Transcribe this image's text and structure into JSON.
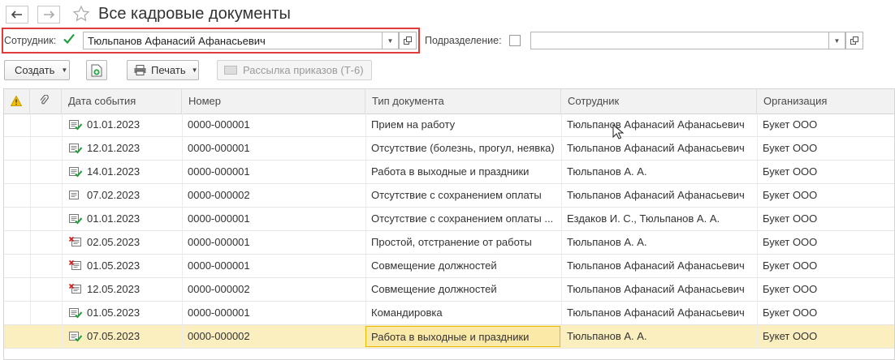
{
  "window": {
    "title": "Все кадровые документы"
  },
  "filters": {
    "employee_label": "Сотрудник:",
    "employee_value": "Тюльпанов Афанасий Афанасьевич",
    "department_label": "Подразделение:",
    "department_value": ""
  },
  "toolbar": {
    "create_label": "Создать",
    "print_label": "Печать",
    "mailing_label": "Рассылка приказов (Т-6)"
  },
  "table": {
    "columns": [
      "Дата события",
      "Номер",
      "Тип документа",
      "Сотрудник",
      "Организация"
    ],
    "rows": [
      {
        "icon": "posted",
        "date": "01.01.2023",
        "number": "0000-000001",
        "type": "Прием на работу",
        "employee": "Тюльпанов Афанасий Афанасьевич",
        "org": "Букет ООО"
      },
      {
        "icon": "posted",
        "date": "12.01.2023",
        "number": "0000-000001",
        "type": "Отсутствие (болезнь, прогул, неявка)",
        "employee": "Тюльпанов Афанасий Афанасьевич",
        "org": "Букет ООО"
      },
      {
        "icon": "posted",
        "date": "14.01.2023",
        "number": "0000-000001",
        "type": "Работа в выходные и праздники",
        "employee": "Тюльпанов А. А.",
        "org": "Букет ООО"
      },
      {
        "icon": "plain",
        "date": "07.02.2023",
        "number": "0000-000002",
        "type": "Отсутствие с сохранением оплаты",
        "employee": "Тюльпанов Афанасий Афанасьевич",
        "org": "Букет ООО"
      },
      {
        "icon": "posted",
        "date": "01.01.2023",
        "number": "0000-000001",
        "type": "Отсутствие с сохранением оплаты ...",
        "employee": "Ездаков И. С., Тюльпанов А. А.",
        "org": "Букет ООО"
      },
      {
        "icon": "deleted",
        "date": "02.05.2023",
        "number": "0000-000001",
        "type": "Простой, отстранение от работы",
        "employee": "Тюльпанов А. А.",
        "org": "Букет ООО"
      },
      {
        "icon": "deleted",
        "date": "01.05.2023",
        "number": "0000-000001",
        "type": "Совмещение должностей",
        "employee": "Тюльпанов Афанасий Афанасьевич",
        "org": "Букет ООО"
      },
      {
        "icon": "deleted",
        "date": "12.05.2023",
        "number": "0000-000002",
        "type": "Совмещение должностей",
        "employee": "Тюльпанов Афанасий Афанасьевич",
        "org": "Букет ООО"
      },
      {
        "icon": "posted",
        "date": "01.05.2023",
        "number": "0000-000001",
        "type": "Командировка",
        "employee": "Тюльпанов Афанасий Афанасьевич",
        "org": "Букет ООО"
      },
      {
        "icon": "posted",
        "date": "07.05.2023",
        "number": "0000-000002",
        "type": "Работа в выходные и праздники",
        "employee": "Тюльпанов А. А.",
        "org": "Букет ООО",
        "selected": true
      }
    ]
  },
  "colors": {
    "accent_red": "#e03c3c",
    "check_green": "#1f9e3a",
    "selected_row": "#fbefc0",
    "current_cell_border": "#e6b800"
  }
}
